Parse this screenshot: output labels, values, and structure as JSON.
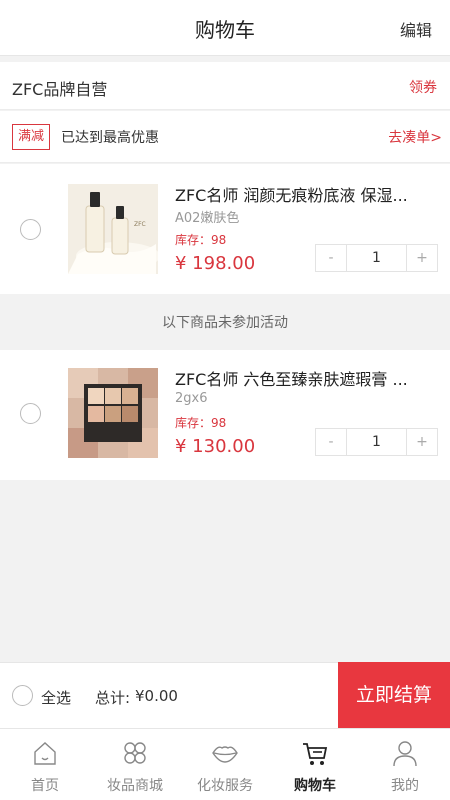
{
  "header": {
    "title": "购物车",
    "edit": "编辑"
  },
  "store": {
    "name": "ZFC品牌自营",
    "coupon": "领券"
  },
  "promo": {
    "tag": "满减",
    "text": "已达到最高优惠",
    "link": "去凑单>"
  },
  "items": [
    {
      "name": "ZFC名师 润颜无痕粉底液 保湿...",
      "spec": "A02嫩肤色",
      "stock": "库存：98",
      "price": "¥ 198.00",
      "qty": "1",
      "minus": "-",
      "plus": "+"
    },
    {
      "name": "ZFC名师 六色至臻亲肤遮瑕膏 ...",
      "spec": "2gx6",
      "stock": "库存：98",
      "price": "¥ 130.00",
      "qty": "1",
      "minus": "-",
      "plus": "+"
    }
  ],
  "section_label": "以下商品未参加活动",
  "bottom": {
    "select_all": "全选",
    "total_label": "总计:",
    "total_value": "¥0.00",
    "checkout": "立即结算"
  },
  "tabs": [
    {
      "label": "首页",
      "icon": "home-icon"
    },
    {
      "label": "妆品商城",
      "icon": "flower-icon"
    },
    {
      "label": "化妆服务",
      "icon": "lips-icon"
    },
    {
      "label": "购物车",
      "icon": "cart-icon",
      "active": true
    },
    {
      "label": "我的",
      "icon": "user-icon"
    }
  ],
  "colors": {
    "accent": "#e8373f",
    "price": "#d9363e"
  }
}
